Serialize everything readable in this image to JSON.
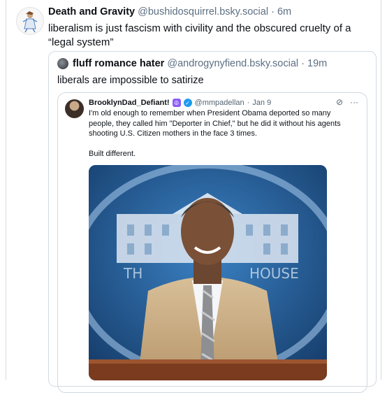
{
  "post": {
    "author_name": "Death and Gravity",
    "author_handle": "@bushidosquirrel.bsky.social",
    "separator": "·",
    "time": "6m",
    "text": "liberalism is just fascism with civility and the obscured cruelty of a “legal system”"
  },
  "quote": {
    "author_name": "fluff romance hater",
    "author_handle": "@androgynyfiend.bsky.social",
    "separator": "·",
    "time": "19m",
    "text": "liberals are impossible to satirize"
  },
  "embedded": {
    "author_name": "BrooklynDad_Defiant!",
    "author_handle": "@mmpadellan",
    "separator": "·",
    "date": "Jan 9",
    "line1": "I'm old enough to remember when President Obama deported so many",
    "line2": "people, they called him \"Deporter in Chief,\" but he did it without his agents",
    "line3": "shooting U.S. Citizen mothers in the face 3 times.",
    "line4": "Built different.",
    "photo_sign": "HOUSE",
    "photo_sign_left": "TH"
  },
  "icons": [
    "avatar-icon",
    "peace-badge-icon",
    "verified-check-icon",
    "grok-icon",
    "more-dots-icon"
  ],
  "colors": {
    "muted": "#5c6f82",
    "verified": "#1d9bf0",
    "badge_purple": "#8b5cf6",
    "photo_blue": "#2d6fb0"
  }
}
